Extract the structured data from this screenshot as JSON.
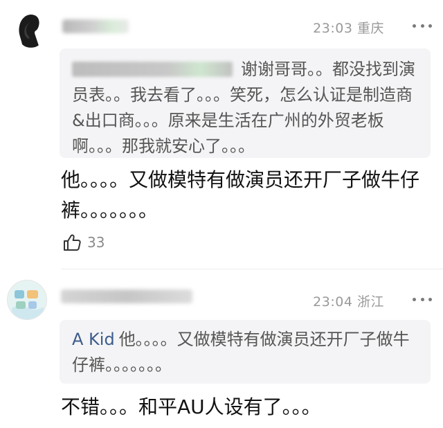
{
  "comments": [
    {
      "time": "23:03",
      "location": "重庆",
      "quote": "谢谢哥哥。。都没找到演员表。。我去看了。。。笑死，怎么认证是制造商&出口商。。。原来是生活在广州的外贸老板啊。。。那我就安心了。。。",
      "text": "他。。。。又做模特有做演员还开厂子做牛仔裤。。。。。。。",
      "likes": "33"
    },
    {
      "time": "23:04",
      "location": "浙江",
      "quote_author": "A Kid",
      "quote": "他。。。。又做模特有做演员还开厂子做牛仔裤。。。。。。。",
      "text": "不错。。。和平AU人设有了。。。"
    }
  ],
  "icons": {
    "more": "more-dots-icon",
    "like": "thumbs-up-icon"
  },
  "colors": {
    "meta": "#999999",
    "quote_bg": "#f4f4f6",
    "quote_author": "#3d5c8c"
  }
}
